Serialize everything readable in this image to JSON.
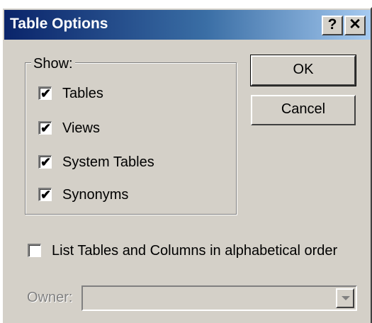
{
  "window": {
    "title": "Table Options",
    "help_label": "?",
    "close_label": "✕"
  },
  "show_group": {
    "legend": "Show:",
    "items": [
      {
        "label": "Tables",
        "checked": true
      },
      {
        "label": "Views",
        "checked": true
      },
      {
        "label": "System Tables",
        "checked": true
      },
      {
        "label": "Synonyms",
        "checked": true
      }
    ]
  },
  "buttons": {
    "ok": "OK",
    "cancel": "Cancel"
  },
  "alphabetical": {
    "label": "List Tables and Columns in alphabetical order",
    "checked": false
  },
  "owner": {
    "label": "Owner:",
    "value": "",
    "enabled": false
  },
  "colors": {
    "face": "#d4d0c8",
    "title_start": "#0a246a",
    "title_end": "#a6caf0",
    "disabled_text": "#808080"
  },
  "check_mark": "✔"
}
